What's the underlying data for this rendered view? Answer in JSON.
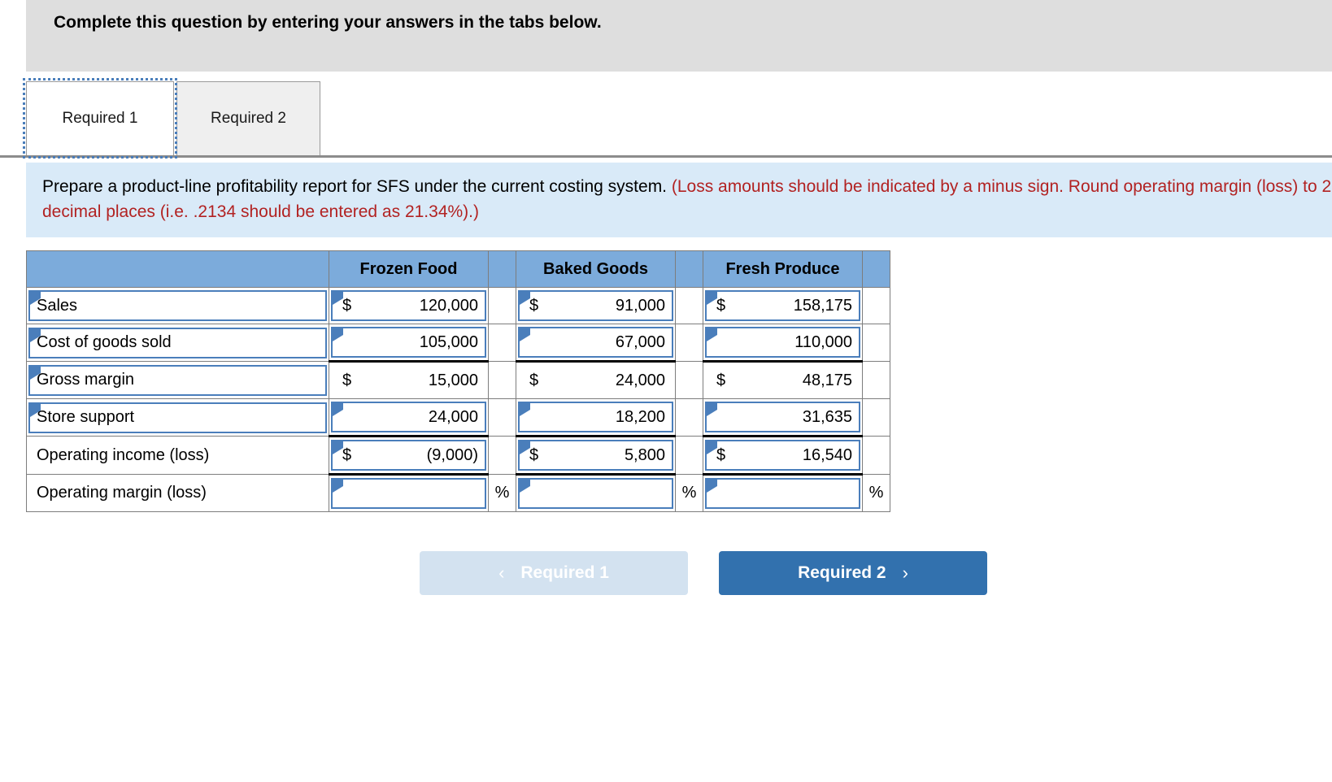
{
  "header": {
    "title": "Complete this question by entering your answers in the tabs below."
  },
  "tabs": [
    {
      "label": "Required 1",
      "active": true
    },
    {
      "label": "Required 2",
      "active": false
    }
  ],
  "prompt": {
    "main": "Prepare a product-line profitability report for SFS under the current costing system. ",
    "note": "(Loss amounts should be indicated by a minus sign. Round operating margin (loss) to 2 decimal places (i.e. .2134 should be entered as 21.34%).)"
  },
  "table": {
    "columns": [
      "",
      "Frozen Food",
      "Baked Goods",
      "Fresh Produce"
    ],
    "rows": [
      {
        "label": "Sales",
        "label_boxed": true,
        "frozen": {
          "currency": "$",
          "value": "120,000",
          "boxed": true
        },
        "baked": {
          "currency": "$",
          "value": "91,000",
          "boxed": true
        },
        "fresh": {
          "currency": "$",
          "value": "158,175",
          "boxed": true
        }
      },
      {
        "label": "Cost of goods sold",
        "label_boxed": true,
        "frozen": {
          "currency": "",
          "value": "105,000",
          "boxed": true
        },
        "baked": {
          "currency": "",
          "value": "67,000",
          "boxed": true
        },
        "fresh": {
          "currency": "",
          "value": "110,000",
          "boxed": true
        }
      },
      {
        "label": "Gross margin",
        "label_boxed": true,
        "rule": "top",
        "frozen": {
          "currency": "$",
          "value": "15,000",
          "boxed": false
        },
        "baked": {
          "currency": "$",
          "value": "24,000",
          "boxed": false
        },
        "fresh": {
          "currency": "$",
          "value": "48,175",
          "boxed": false
        }
      },
      {
        "label": "Store support",
        "label_boxed": true,
        "frozen": {
          "currency": "",
          "value": "24,000",
          "boxed": true
        },
        "baked": {
          "currency": "",
          "value": "18,200",
          "boxed": true
        },
        "fresh": {
          "currency": "",
          "value": "31,635",
          "boxed": true
        }
      },
      {
        "label": "Operating income (loss)",
        "label_boxed": false,
        "rule": "both",
        "frozen": {
          "currency": "$",
          "value": "(9,000)",
          "boxed": true
        },
        "baked": {
          "currency": "$",
          "value": "5,800",
          "boxed": true
        },
        "fresh": {
          "currency": "$",
          "value": "16,540",
          "boxed": true
        }
      },
      {
        "label": "Operating margin (loss)",
        "label_boxed": false,
        "frozen": {
          "currency": "",
          "value": "",
          "boxed": true
        },
        "baked": {
          "currency": "",
          "value": "",
          "boxed": true
        },
        "fresh": {
          "currency": "",
          "value": "",
          "boxed": true
        },
        "suffix": "%"
      }
    ],
    "percent_symbol": "%"
  },
  "nav": {
    "prev_label": "Required 1",
    "prev_chevron": "‹",
    "next_label": "Required 2",
    "next_chevron": "›"
  },
  "colors": {
    "header_blue": "#7cabdb",
    "prompt_blue": "#d9eaf8",
    "band_gray": "#dedede",
    "accent_blue": "#4a7ebb",
    "button_blue": "#3271ae",
    "button_disabled": "#d3e2f0",
    "note_red": "#b22222"
  }
}
